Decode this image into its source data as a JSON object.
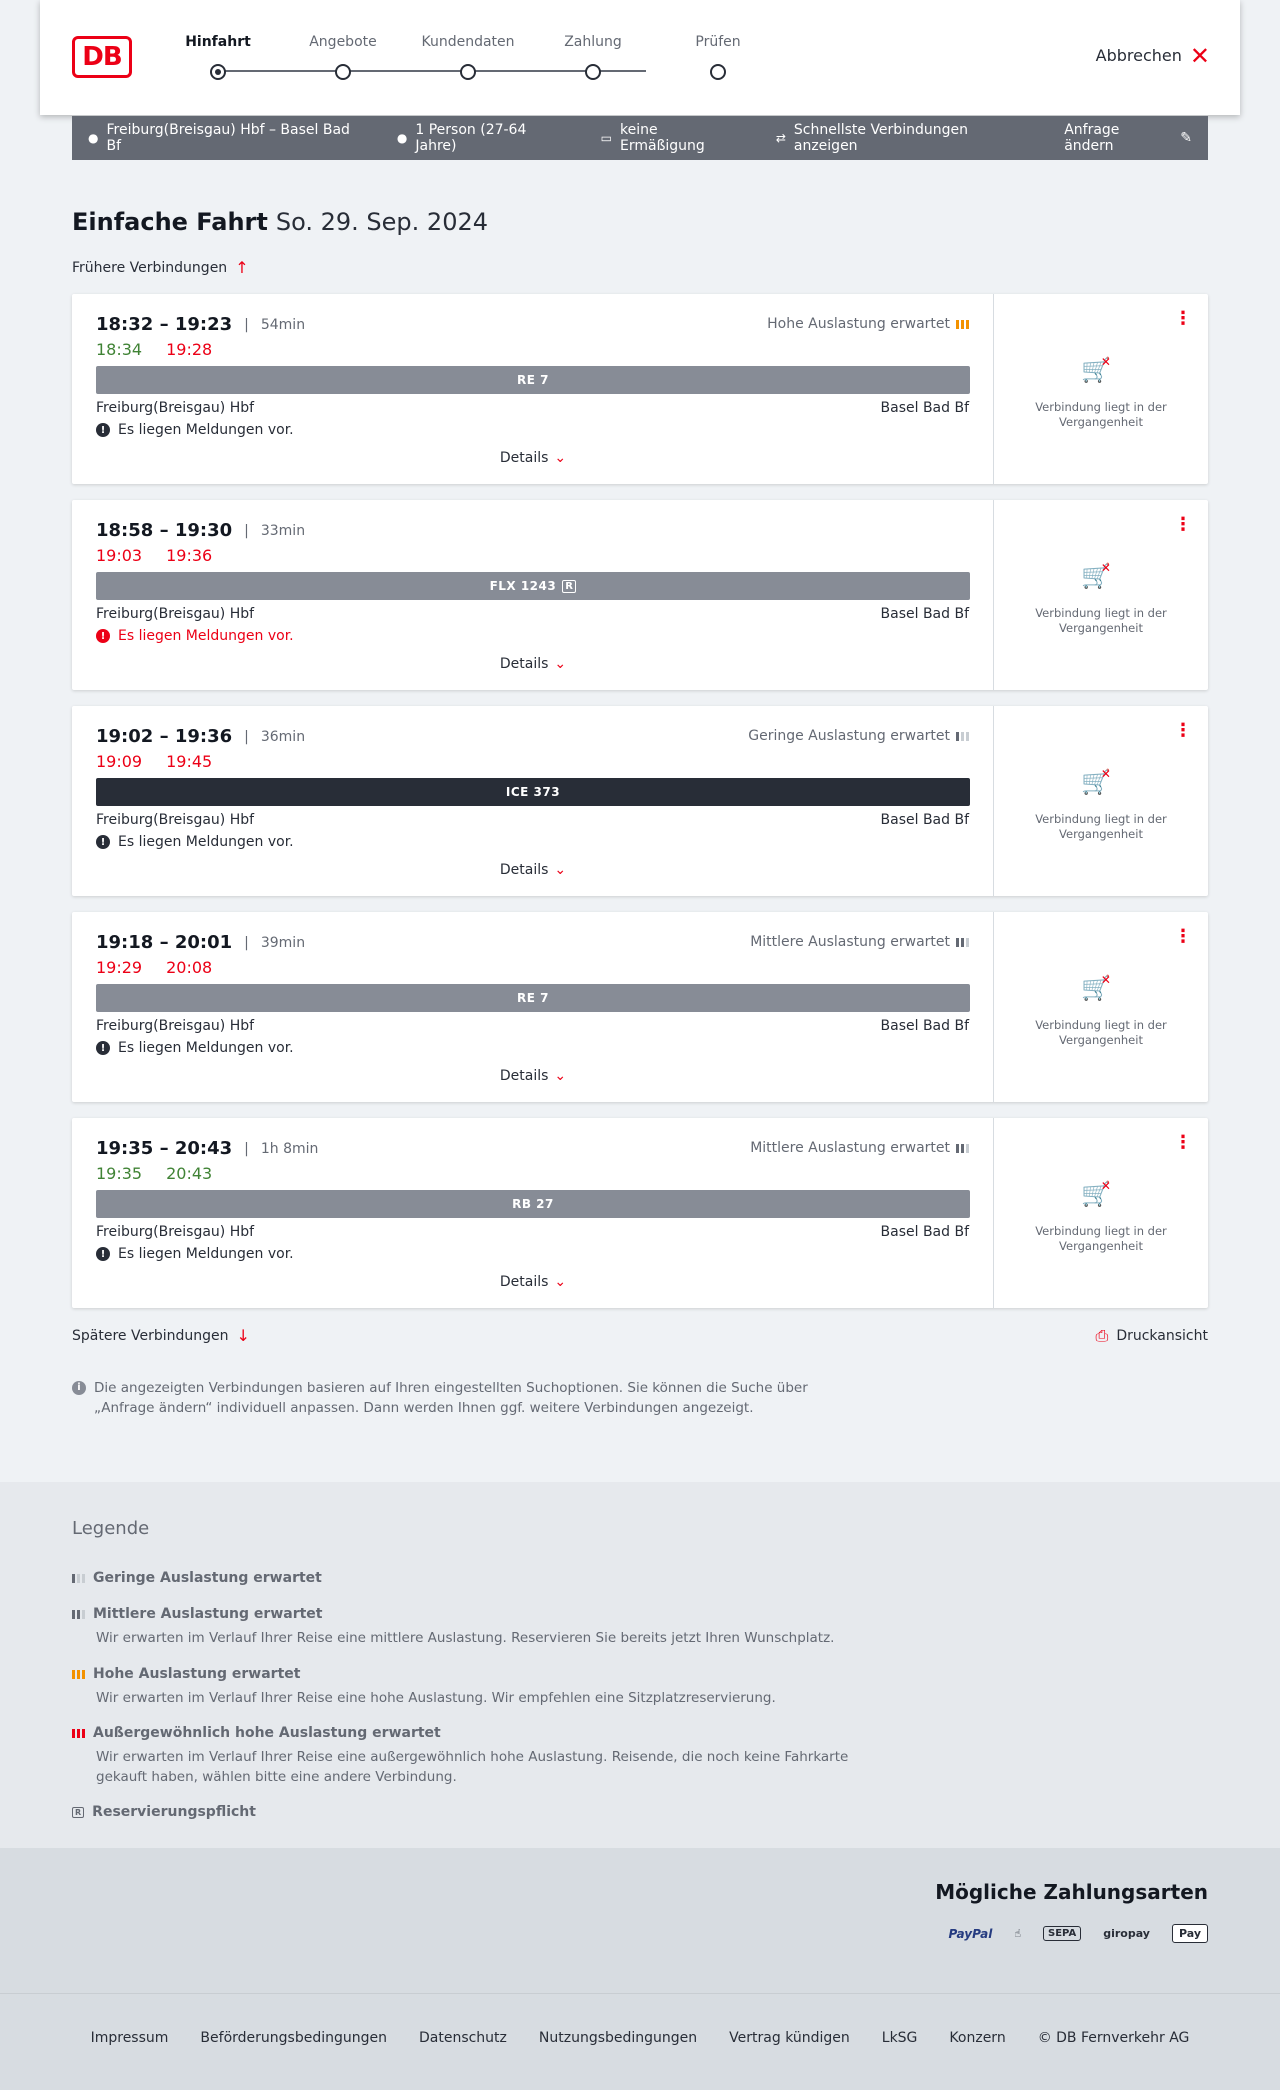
{
  "header": {
    "logo": "DB",
    "steps": [
      {
        "label": "Hinfahrt",
        "active": true
      },
      {
        "label": "Angebote",
        "active": false
      },
      {
        "label": "Kundendaten",
        "active": false
      },
      {
        "label": "Zahlung",
        "active": false
      },
      {
        "label": "Prüfen",
        "active": false
      }
    ],
    "cancel_label": "Abbrechen"
  },
  "search": {
    "route": "Freiburg(Breisgau) Hbf – Basel Bad Bf",
    "travelers": "1 Person (27-64 Jahre)",
    "discount": "keine Ermäßigung",
    "mode": "Schnellste Verbindungen anzeigen",
    "change_label": "Anfrage ändern"
  },
  "title": {
    "main": "Einfache Fahrt",
    "date": "So. 29. Sep. 2024"
  },
  "earlier_label": "Frühere Verbindungen",
  "later_label": "Spätere Verbindungen",
  "print_label": "Druckansicht",
  "connections": [
    {
      "dep": "18:32",
      "arr": "19:23",
      "duration": "54min",
      "rt_dep": "18:34",
      "rt_dep_status": "green",
      "rt_arr": "19:28",
      "rt_arr_status": "red",
      "load": "Hohe Auslastung erwartet",
      "load_level": 3,
      "train": "RE 7",
      "train_style": "grey",
      "reservation": false,
      "from": "Freiburg(Breisgau) Hbf",
      "to": "Basel Bad Bf",
      "message": "Es liegen Meldungen vor.",
      "message_red": false,
      "details": "Details",
      "status": "Verbindung liegt in der Vergangenheit"
    },
    {
      "dep": "18:58",
      "arr": "19:30",
      "duration": "33min",
      "rt_dep": "19:03",
      "rt_dep_status": "red",
      "rt_arr": "19:36",
      "rt_arr_status": "red",
      "load": "",
      "load_level": 0,
      "train": "FLX 1243",
      "train_style": "grey",
      "reservation": true,
      "from": "Freiburg(Breisgau) Hbf",
      "to": "Basel Bad Bf",
      "message": "Es liegen Meldungen vor.",
      "message_red": true,
      "details": "Details",
      "status": "Verbindung liegt in der Vergangenheit"
    },
    {
      "dep": "19:02",
      "arr": "19:36",
      "duration": "36min",
      "rt_dep": "19:09",
      "rt_dep_status": "red",
      "rt_arr": "19:45",
      "rt_arr_status": "red",
      "load": "Geringe Auslastung erwartet",
      "load_level": 1,
      "train": "ICE 373",
      "train_style": "dark",
      "reservation": false,
      "from": "Freiburg(Breisgau) Hbf",
      "to": "Basel Bad Bf",
      "message": "Es liegen Meldungen vor.",
      "message_red": false,
      "details": "Details",
      "status": "Verbindung liegt in der Vergangenheit"
    },
    {
      "dep": "19:18",
      "arr": "20:01",
      "duration": "39min",
      "rt_dep": "19:29",
      "rt_dep_status": "red",
      "rt_arr": "20:08",
      "rt_arr_status": "red",
      "load": "Mittlere Auslastung erwartet",
      "load_level": 2,
      "train": "RE 7",
      "train_style": "grey",
      "reservation": false,
      "from": "Freiburg(Breisgau) Hbf",
      "to": "Basel Bad Bf",
      "message": "Es liegen Meldungen vor.",
      "message_red": false,
      "details": "Details",
      "status": "Verbindung liegt in der Vergangenheit"
    },
    {
      "dep": "19:35",
      "arr": "20:43",
      "duration": "1h 8min",
      "rt_dep": "19:35",
      "rt_dep_status": "green",
      "rt_arr": "20:43",
      "rt_arr_status": "green",
      "load": "Mittlere Auslastung erwartet",
      "load_level": 2,
      "train": "RB 27",
      "train_style": "grey",
      "reservation": false,
      "from": "Freiburg(Breisgau) Hbf",
      "to": "Basel Bad Bf",
      "message": "Es liegen Meldungen vor.",
      "message_red": false,
      "details": "Details",
      "status": "Verbindung liegt in der Vergangenheit"
    }
  ],
  "info_text": "Die angezeigten Verbindungen basieren auf Ihren eingestellten Suchoptionen. Sie können die Suche über „Anfrage ändern“ individuell anpassen. Dann werden Ihnen ggf. weitere Verbindungen angezeigt.",
  "legend": {
    "title": "Legende",
    "items": [
      {
        "title": "Geringe Auslastung erwartet",
        "desc": ""
      },
      {
        "title": "Mittlere Auslastung erwartet",
        "desc": "Wir erwarten im Verlauf Ihrer Reise eine mittlere Auslastung. Reservieren Sie bereits jetzt Ihren Wunschplatz."
      },
      {
        "title": "Hohe Auslastung erwartet",
        "desc": "Wir erwarten im Verlauf Ihrer Reise eine hohe Auslastung. Wir empfehlen eine Sitzplatzreservierung."
      },
      {
        "title": "Außergewöhnlich hohe Auslastung erwartet",
        "desc": "Wir erwarten im Verlauf Ihrer Reise eine außergewöhnlich hohe Auslastung. Reisende, die noch keine Fahrkarte gekauft haben, wählen bitte eine andere Verbindung."
      },
      {
        "title": "Reservierungspflicht",
        "desc": ""
      }
    ]
  },
  "payments": {
    "title": "Mögliche Zahlungsarten",
    "paypal": "PayPal",
    "sepa": "SEPA",
    "giropay": "giropay",
    "applepay": "Pay"
  },
  "footer": {
    "links": [
      "Impressum",
      "Beförderungsbedingungen",
      "Datenschutz",
      "Nutzungsbedingungen",
      "Vertrag kündigen",
      "LkSG",
      "Konzern",
      "© DB Fernverkehr AG"
    ]
  },
  "colors": {
    "brand_red": "#ec0016",
    "ontime_green": "#408335",
    "high_load_orange": "#f39200",
    "bar_grey": "#878c96",
    "bar_dark": "#282d37"
  }
}
